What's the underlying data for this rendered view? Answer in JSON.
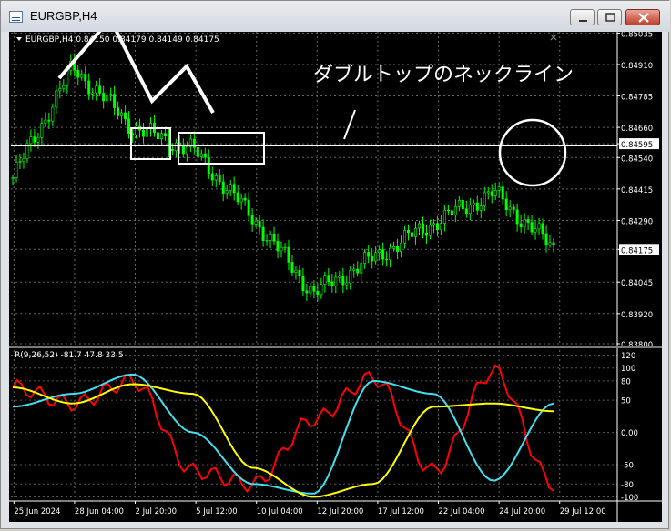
{
  "window": {
    "title": "EURGBP,H4",
    "buttons": [
      "minimize",
      "maximize",
      "close"
    ]
  },
  "chart": {
    "header": "EURGBP,H4  0.84150 0.84179 0.84149 0.84175",
    "price_ticks": [
      "0.85035",
      "0.84910",
      "0.84785",
      "0.84660",
      "0.84595",
      "0.84540",
      "0.84415",
      "0.84290",
      "0.84175",
      "0.84045",
      "0.83920",
      "0.83800"
    ],
    "neckline_price": "0.84595",
    "current_price": "0.84175",
    "annotation": "ダブルトップのネックライン",
    "date_ticks": [
      "25 Jun 2024",
      "28 Jun 04:00",
      "2 Jul 20:00",
      "5 Jul 12:00",
      "10 Jul 04:00",
      "12 Jul 20:00",
      "17 Jul 12:00",
      "22 Jul 04:00",
      "24 Jul 20:00",
      "29 Jul 12:00"
    ],
    "colors": {
      "background": "#000000",
      "candles": "#00ff00",
      "neckline": "#ffffff",
      "annotation": "#ffffff",
      "indicator_red": "#ff0000",
      "indicator_cyan": "#40e0f0",
      "indicator_yellow": "#ffff00"
    }
  },
  "indicator": {
    "header": "R(9,26,52) -81.7 47.8 33.5",
    "ticks": [
      "120",
      "100",
      "80",
      "50",
      "0.00",
      "-50",
      "-80",
      "-100"
    ]
  },
  "chart_data": {
    "type": "line",
    "x": [
      "25 Jun 2024",
      "28 Jun 04:00",
      "2 Jul 20:00",
      "5 Jul 12:00",
      "10 Jul 04:00",
      "12 Jul 20:00",
      "17 Jul 12:00",
      "22 Jul 04:00",
      "24 Jul 20:00",
      "29 Jul 12:00"
    ],
    "series": [
      {
        "values": [
          0.8446,
          0.849,
          0.8466,
          0.8457,
          0.843,
          0.84,
          0.8414,
          0.8428,
          0.844,
          0.8418
        ]
      }
    ],
    "ylim": [
      0.838,
      0.8504
    ],
    "indicator_series": [
      {
        "values": [
          70,
          45,
          80,
          -60,
          -80,
          20,
          85,
          -60,
          95,
          -80
        ]
      },
      {
        "values": [
          40,
          60,
          90,
          0,
          -80,
          -95,
          80,
          60,
          -75,
          45
        ]
      },
      {
        "values": [
          70,
          45,
          75,
          60,
          -55,
          -100,
          -80,
          40,
          45,
          33
        ]
      }
    ],
    "indicator_ylim": [
      -105,
      125
    ]
  }
}
